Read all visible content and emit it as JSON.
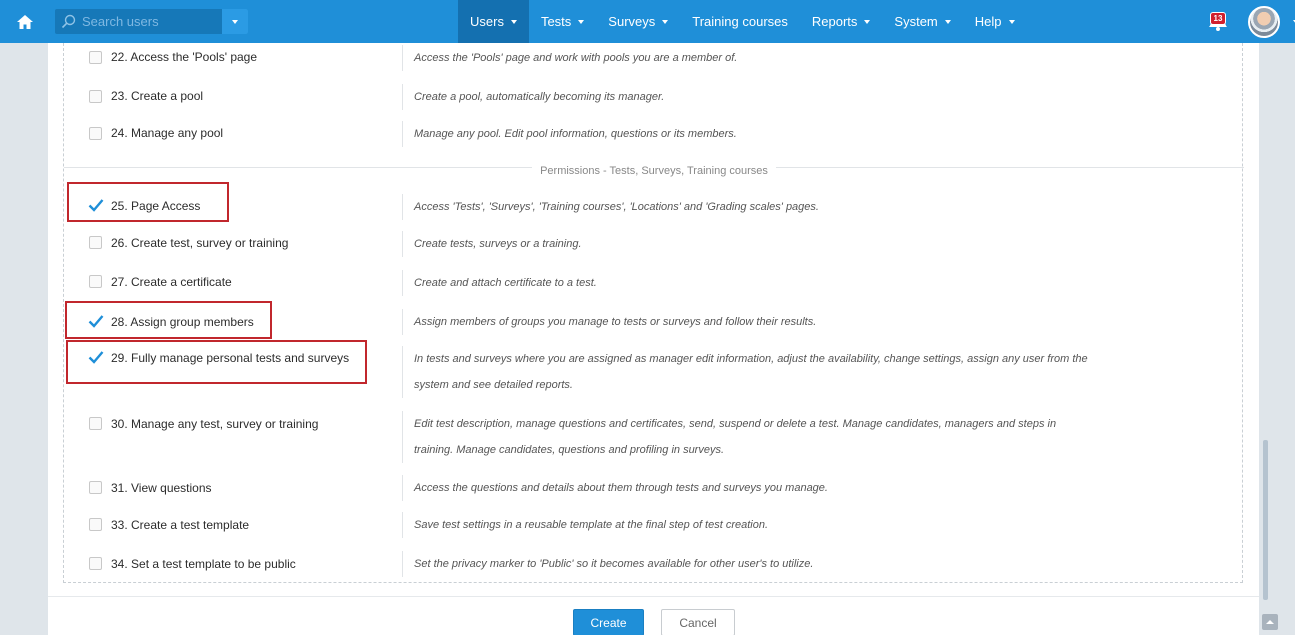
{
  "nav": {
    "search_placeholder": "Search users",
    "items": [
      {
        "label": "Users",
        "dropdown": true,
        "active": true
      },
      {
        "label": "Tests",
        "dropdown": true
      },
      {
        "label": "Surveys",
        "dropdown": true
      },
      {
        "label": "Training courses",
        "dropdown": false
      },
      {
        "label": "Reports",
        "dropdown": true
      },
      {
        "label": "System",
        "dropdown": true
      },
      {
        "label": "Help",
        "dropdown": true
      }
    ],
    "notification_count": "13",
    "accent_color": "#1f8fd8"
  },
  "permissions_top": [
    {
      "label": "22. Access the 'Pools' page",
      "desc": "Access the 'Pools' page and work with pools you are a member of.",
      "checked": false
    },
    {
      "label": "23. Create a pool",
      "desc": "Create a pool, automatically becoming its manager.",
      "checked": false
    },
    {
      "label": "24. Manage any pool",
      "desc": "Manage any pool. Edit pool information, questions or its members.",
      "checked": false
    }
  ],
  "section_title": "Permissions - Tests, Surveys, Training courses",
  "permissions": [
    {
      "label": "25. Page Access",
      "desc": "Access 'Tests', 'Surveys', 'Training courses', 'Locations' and 'Grading scales' pages.",
      "checked": true,
      "highlighted": true
    },
    {
      "label": "26. Create test, survey or training",
      "desc": "Create tests, surveys or a training.",
      "checked": false
    },
    {
      "label": "27. Create a certificate",
      "desc": "Create and attach certificate to a test.",
      "checked": false
    },
    {
      "label": "28. Assign group members",
      "desc": "Assign members of groups you manage to tests or surveys and follow their results.",
      "checked": true,
      "highlighted": true
    },
    {
      "label": "29. Fully manage personal tests and surveys",
      "desc": "In tests and surveys where you are assigned as manager edit information, adjust the availability, change settings, assign any user from the",
      "desc2": "system and see detailed reports.",
      "checked": true,
      "highlighted": true
    },
    {
      "label": "30. Manage any test, survey or training",
      "desc": "Edit test description, manage questions and certificates, send, suspend or delete a test. Manage candidates, managers and steps in",
      "desc2": "training. Manage candidates, questions and profiling in surveys.",
      "checked": false
    },
    {
      "label": "31. View questions",
      "desc": "Access the questions and details about them through tests and surveys you manage.",
      "checked": false
    },
    {
      "label": "33. Create a test template",
      "desc": "Save test settings in a reusable template at the final step of test creation.",
      "checked": false
    },
    {
      "label": "34. Set a test template to be public",
      "desc": "Set the privacy marker to 'Public' so it becomes available for other user's to utilize.",
      "checked": false
    }
  ],
  "buttons": {
    "create": "Create",
    "cancel": "Cancel"
  }
}
